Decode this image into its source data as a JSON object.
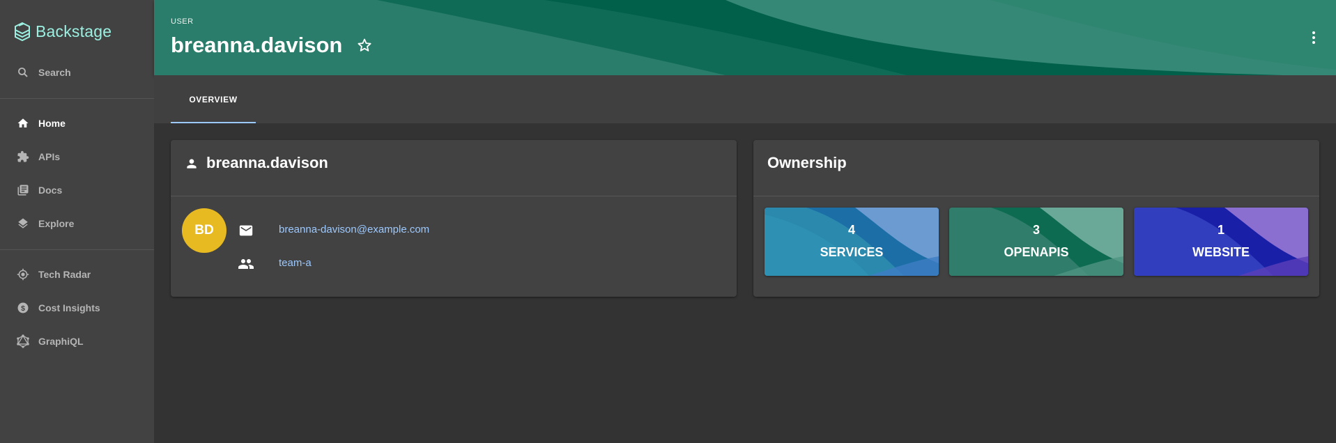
{
  "app": {
    "name": "Backstage",
    "accent": "#9BF0E1"
  },
  "sidebar": {
    "search_label": "Search",
    "items": [
      {
        "label": "Home",
        "icon": "home-icon",
        "active": true
      },
      {
        "label": "APIs",
        "icon": "puzzle-icon"
      },
      {
        "label": "Docs",
        "icon": "library-books-icon"
      },
      {
        "label": "Explore",
        "icon": "layers-icon"
      }
    ],
    "plugins": [
      {
        "label": "Tech Radar",
        "icon": "radar-icon"
      },
      {
        "label": "Cost Insights",
        "icon": "dollar-circle-icon"
      },
      {
        "label": "GraphiQL",
        "icon": "graphql-icon"
      }
    ]
  },
  "header": {
    "type_label": "USER",
    "title": "breanna.davison",
    "star_icon": "star-outline-icon",
    "menu_icon": "more-vert-icon"
  },
  "tabs": [
    {
      "label": "OVERVIEW",
      "active": true
    }
  ],
  "user_card": {
    "title": "breanna.davison",
    "avatar_initials": "BD",
    "avatar_color": "#e8ba22",
    "email": "breanna-davison@example.com",
    "group": "team-a"
  },
  "ownership": {
    "title": "Ownership",
    "tiles": [
      {
        "count": "4",
        "label": "SERVICES"
      },
      {
        "count": "3",
        "label": "OPENAPIS"
      },
      {
        "count": "1",
        "label": "WEBSITE"
      }
    ]
  }
}
